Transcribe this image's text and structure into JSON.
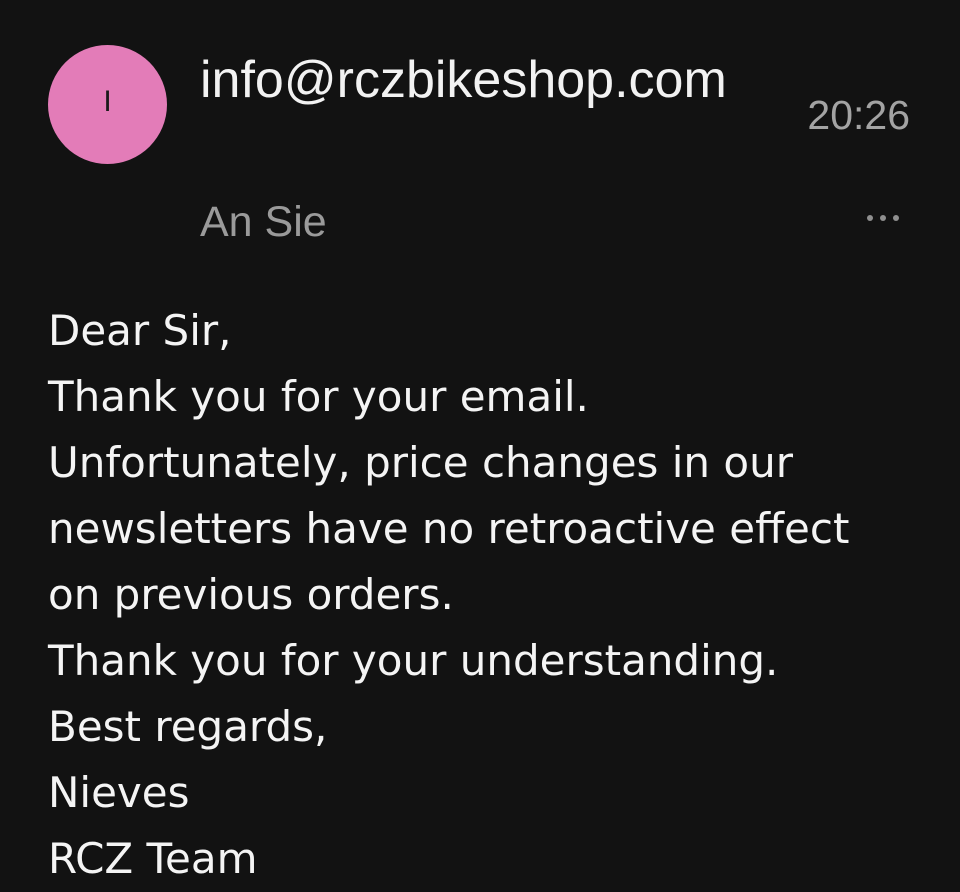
{
  "email": {
    "avatar_initial": "I",
    "sender": "info@rczbikeshop.com",
    "recipient": "An Sie",
    "time": "20:26",
    "body_lines": [
      "Dear Sir,",
      "Thank you for your email.",
      "Unfortunately, price changes in our",
      "newsletters have no retroactive effect",
      "on previous orders.",
      "Thank you for your understanding.",
      "Best regards,",
      "Nieves",
      "RCZ Team"
    ]
  },
  "colors": {
    "background": "#121212",
    "avatar": "#e37cb8",
    "primary_text": "#f2f2f2",
    "secondary_text": "#9a9a9a"
  },
  "icons": {
    "more": "more-horizontal-icon"
  }
}
